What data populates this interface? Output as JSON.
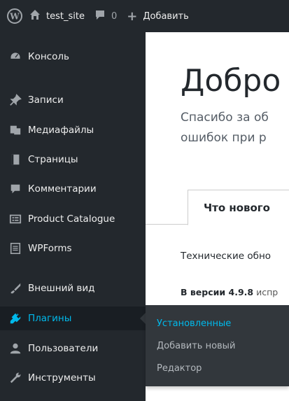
{
  "adminbar": {
    "site_name": "test_site",
    "comments_count": "0",
    "new_label": "Добавить"
  },
  "sidebar": {
    "items": [
      {
        "label": "Консоль",
        "icon": "dashboard-icon"
      },
      {
        "label": "Записи",
        "icon": "pin-icon"
      },
      {
        "label": "Медиафайлы",
        "icon": "media-icon"
      },
      {
        "label": "Страницы",
        "icon": "pages-icon"
      },
      {
        "label": "Комментарии",
        "icon": "comments-icon"
      },
      {
        "label": "Product Catalogue",
        "icon": "catalogue-icon"
      },
      {
        "label": "WPForms",
        "icon": "forms-icon"
      },
      {
        "label": "Внешний вид",
        "icon": "appearance-icon"
      },
      {
        "label": "Плагины",
        "icon": "plugins-icon",
        "active": true
      },
      {
        "label": "Пользователи",
        "icon": "users-icon"
      },
      {
        "label": "Инструменты",
        "icon": "tools-icon"
      }
    ]
  },
  "flyout": {
    "items": [
      {
        "label": "Установленные",
        "current": true
      },
      {
        "label": "Добавить новый"
      },
      {
        "label": "Редактор"
      }
    ]
  },
  "main": {
    "title": "Добро",
    "intro_line1": "Спасибо за об",
    "intro_line2": "ошибок при р",
    "tab_label": "Что нового",
    "section_heading": "Технические обно",
    "section_text_bold": "В версии 4.9.8",
    "section_text_rest": " испр"
  },
  "colors": {
    "sidebar_bg": "#23282d",
    "active_accent": "#00b9eb",
    "flyout_bg": "#32373c"
  }
}
